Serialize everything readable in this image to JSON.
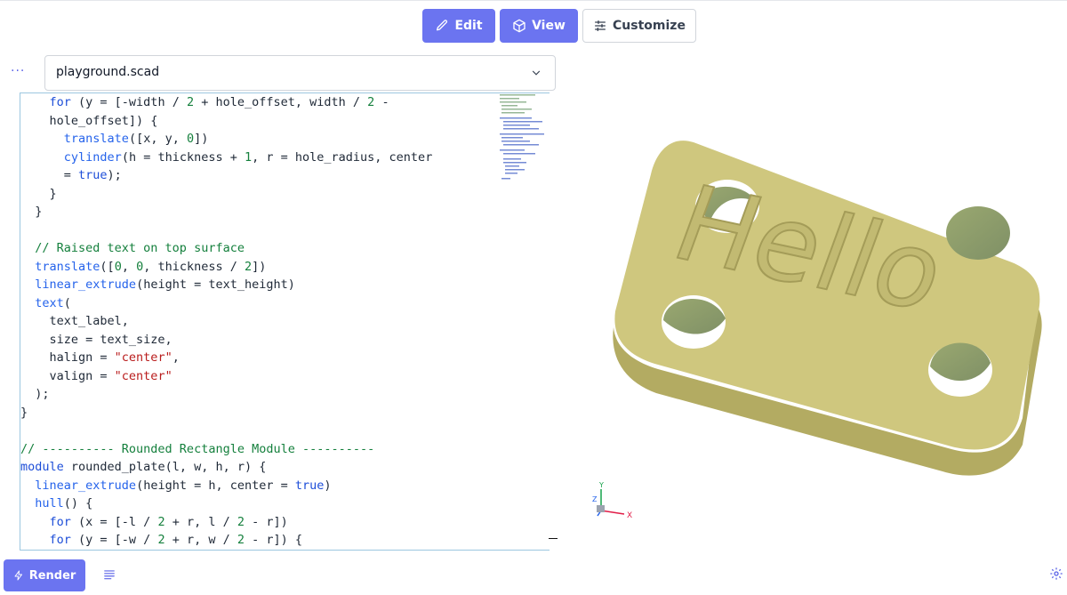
{
  "toolbar": {
    "edit_label": "Edit",
    "view_label": "View",
    "customize_label": "Customize"
  },
  "file": {
    "menu_dots": "···",
    "name": "playground.scad"
  },
  "code_lines": [
    "    for (y = [-width / 2 + hole_offset, width / 2 -",
    "    hole_offset]) {",
    "      translate([x, y, 0])",
    "      cylinder(h = thickness + 1, r = hole_radius, center",
    "      = true);",
    "    }",
    "  }",
    "",
    "  // Raised text on top surface",
    "  translate([0, 0, thickness / 2])",
    "  linear_extrude(height = text_height)",
    "  text(",
    "    text_label,",
    "    size = text_size,",
    "    halign = \"center\",",
    "    valign = \"center\"",
    "  );",
    "}",
    "",
    "// ---------- Rounded Rectangle Module ----------",
    "module rounded_plate(l, w, h, r) {",
    "  linear_extrude(height = h, center = true)",
    "  hull() {",
    "    for (x = [-l / 2 + r, l / 2 - r])",
    "    for (y = [-w / 2 + r, w / 2 - r]) {"
  ],
  "viewer": {
    "model_text": "Hello",
    "model_color": "#cfc77e",
    "axis_x_label": "X",
    "axis_y_label": "Y",
    "axis_z_label": "Z"
  },
  "bottom": {
    "render_label": "Render"
  },
  "icons": {
    "edit": "pencil-icon",
    "view": "cube-icon",
    "customize": "sliders-icon",
    "render": "lightning-icon",
    "log": "list-icon",
    "settings": "gear-icon"
  },
  "colors": {
    "accent": "#6b74f0",
    "model": "#cfc77e"
  }
}
